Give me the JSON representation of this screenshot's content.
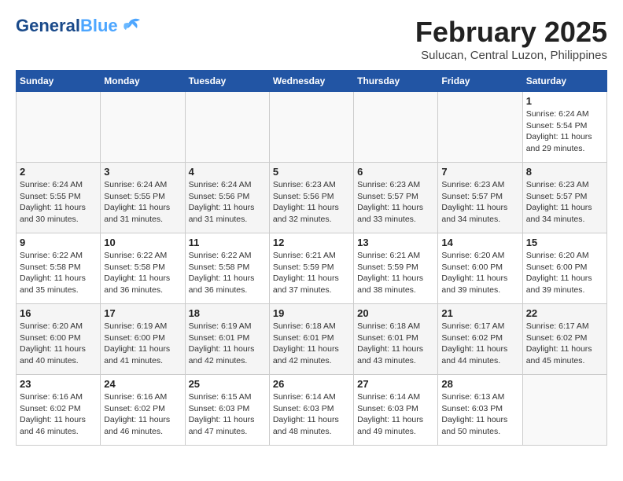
{
  "header": {
    "logo_general": "General",
    "logo_blue": "Blue",
    "month_title": "February 2025",
    "subtitle": "Sulucan, Central Luzon, Philippines"
  },
  "days_of_week": [
    "Sunday",
    "Monday",
    "Tuesday",
    "Wednesday",
    "Thursday",
    "Friday",
    "Saturday"
  ],
  "weeks": [
    [
      {
        "day": "",
        "info": ""
      },
      {
        "day": "",
        "info": ""
      },
      {
        "day": "",
        "info": ""
      },
      {
        "day": "",
        "info": ""
      },
      {
        "day": "",
        "info": ""
      },
      {
        "day": "",
        "info": ""
      },
      {
        "day": "1",
        "info": "Sunrise: 6:24 AM\nSunset: 5:54 PM\nDaylight: 11 hours\nand 29 minutes."
      }
    ],
    [
      {
        "day": "2",
        "info": "Sunrise: 6:24 AM\nSunset: 5:55 PM\nDaylight: 11 hours\nand 30 minutes."
      },
      {
        "day": "3",
        "info": "Sunrise: 6:24 AM\nSunset: 5:55 PM\nDaylight: 11 hours\nand 31 minutes."
      },
      {
        "day": "4",
        "info": "Sunrise: 6:24 AM\nSunset: 5:56 PM\nDaylight: 11 hours\nand 31 minutes."
      },
      {
        "day": "5",
        "info": "Sunrise: 6:23 AM\nSunset: 5:56 PM\nDaylight: 11 hours\nand 32 minutes."
      },
      {
        "day": "6",
        "info": "Sunrise: 6:23 AM\nSunset: 5:57 PM\nDaylight: 11 hours\nand 33 minutes."
      },
      {
        "day": "7",
        "info": "Sunrise: 6:23 AM\nSunset: 5:57 PM\nDaylight: 11 hours\nand 34 minutes."
      },
      {
        "day": "8",
        "info": "Sunrise: 6:23 AM\nSunset: 5:57 PM\nDaylight: 11 hours\nand 34 minutes."
      }
    ],
    [
      {
        "day": "9",
        "info": "Sunrise: 6:22 AM\nSunset: 5:58 PM\nDaylight: 11 hours\nand 35 minutes."
      },
      {
        "day": "10",
        "info": "Sunrise: 6:22 AM\nSunset: 5:58 PM\nDaylight: 11 hours\nand 36 minutes."
      },
      {
        "day": "11",
        "info": "Sunrise: 6:22 AM\nSunset: 5:58 PM\nDaylight: 11 hours\nand 36 minutes."
      },
      {
        "day": "12",
        "info": "Sunrise: 6:21 AM\nSunset: 5:59 PM\nDaylight: 11 hours\nand 37 minutes."
      },
      {
        "day": "13",
        "info": "Sunrise: 6:21 AM\nSunset: 5:59 PM\nDaylight: 11 hours\nand 38 minutes."
      },
      {
        "day": "14",
        "info": "Sunrise: 6:20 AM\nSunset: 6:00 PM\nDaylight: 11 hours\nand 39 minutes."
      },
      {
        "day": "15",
        "info": "Sunrise: 6:20 AM\nSunset: 6:00 PM\nDaylight: 11 hours\nand 39 minutes."
      }
    ],
    [
      {
        "day": "16",
        "info": "Sunrise: 6:20 AM\nSunset: 6:00 PM\nDaylight: 11 hours\nand 40 minutes."
      },
      {
        "day": "17",
        "info": "Sunrise: 6:19 AM\nSunset: 6:00 PM\nDaylight: 11 hours\nand 41 minutes."
      },
      {
        "day": "18",
        "info": "Sunrise: 6:19 AM\nSunset: 6:01 PM\nDaylight: 11 hours\nand 42 minutes."
      },
      {
        "day": "19",
        "info": "Sunrise: 6:18 AM\nSunset: 6:01 PM\nDaylight: 11 hours\nand 42 minutes."
      },
      {
        "day": "20",
        "info": "Sunrise: 6:18 AM\nSunset: 6:01 PM\nDaylight: 11 hours\nand 43 minutes."
      },
      {
        "day": "21",
        "info": "Sunrise: 6:17 AM\nSunset: 6:02 PM\nDaylight: 11 hours\nand 44 minutes."
      },
      {
        "day": "22",
        "info": "Sunrise: 6:17 AM\nSunset: 6:02 PM\nDaylight: 11 hours\nand 45 minutes."
      }
    ],
    [
      {
        "day": "23",
        "info": "Sunrise: 6:16 AM\nSunset: 6:02 PM\nDaylight: 11 hours\nand 46 minutes."
      },
      {
        "day": "24",
        "info": "Sunrise: 6:16 AM\nSunset: 6:02 PM\nDaylight: 11 hours\nand 46 minutes."
      },
      {
        "day": "25",
        "info": "Sunrise: 6:15 AM\nSunset: 6:03 PM\nDaylight: 11 hours\nand 47 minutes."
      },
      {
        "day": "26",
        "info": "Sunrise: 6:14 AM\nSunset: 6:03 PM\nDaylight: 11 hours\nand 48 minutes."
      },
      {
        "day": "27",
        "info": "Sunrise: 6:14 AM\nSunset: 6:03 PM\nDaylight: 11 hours\nand 49 minutes."
      },
      {
        "day": "28",
        "info": "Sunrise: 6:13 AM\nSunset: 6:03 PM\nDaylight: 11 hours\nand 50 minutes."
      },
      {
        "day": "",
        "info": ""
      }
    ]
  ]
}
